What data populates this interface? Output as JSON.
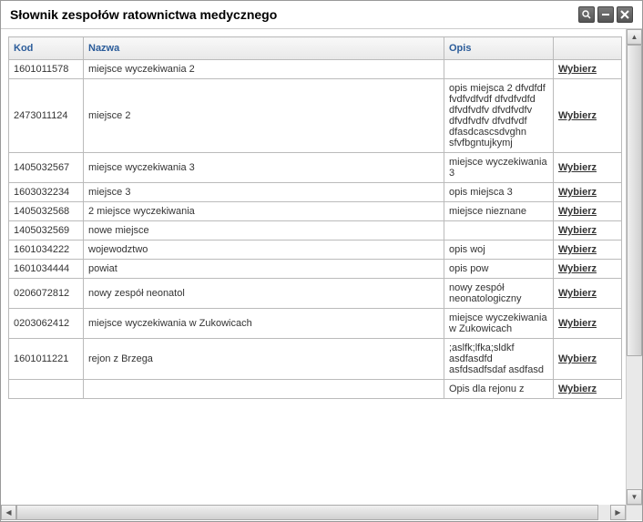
{
  "window": {
    "title": "Słownik zespołów ratownictwa medycznego"
  },
  "table": {
    "headers": {
      "kod": "Kod",
      "nazwa": "Nazwa",
      "opis": "Opis",
      "action": ""
    },
    "action_label": "Wybierz",
    "rows": [
      {
        "kod": "1601011578",
        "nazwa": "miejsce wyczekiwania 2",
        "opis": ""
      },
      {
        "kod": "2473011124",
        "nazwa": "miejsce 2",
        "opis": "opis miejsca 2 dfvdfdf fvdfvdfvdf dfvdfvdfd dfvdfvdfv dfvdfvdfv dfvdfvdfv dfvdfvdf dfasdcascsdvghn sfvfbgntujkymj"
      },
      {
        "kod": "1405032567",
        "nazwa": "miejsce wyczekiwania 3",
        "opis": "miejsce wyczekiwania 3"
      },
      {
        "kod": "1603032234",
        "nazwa": "miejsce 3",
        "opis": "opis miejsca 3"
      },
      {
        "kod": "1405032568",
        "nazwa": "2 miejsce wyczekiwania",
        "opis": "miejsce nieznane"
      },
      {
        "kod": "1405032569",
        "nazwa": "nowe miejsce",
        "opis": ""
      },
      {
        "kod": "1601034222",
        "nazwa": "wojewodztwo",
        "opis": "opis woj"
      },
      {
        "kod": "1601034444",
        "nazwa": "powiat",
        "opis": "opis pow"
      },
      {
        "kod": "0206072812",
        "nazwa": "nowy zespół neonatol",
        "opis": "nowy zespół neonatologiczny"
      },
      {
        "kod": "0203062412",
        "nazwa": "miejsce wyczekiwania w Zukowicach",
        "opis": "miejsce wyczekiwania w Zukowicach"
      },
      {
        "kod": "1601011221",
        "nazwa": "rejon z Brzega",
        "opis": ";aslfk;lfka;sldkf asdfasdfd asfdsadfsdaf asdfasd"
      },
      {
        "kod": "",
        "nazwa": "",
        "opis": "Opis dla rejonu z"
      }
    ]
  }
}
